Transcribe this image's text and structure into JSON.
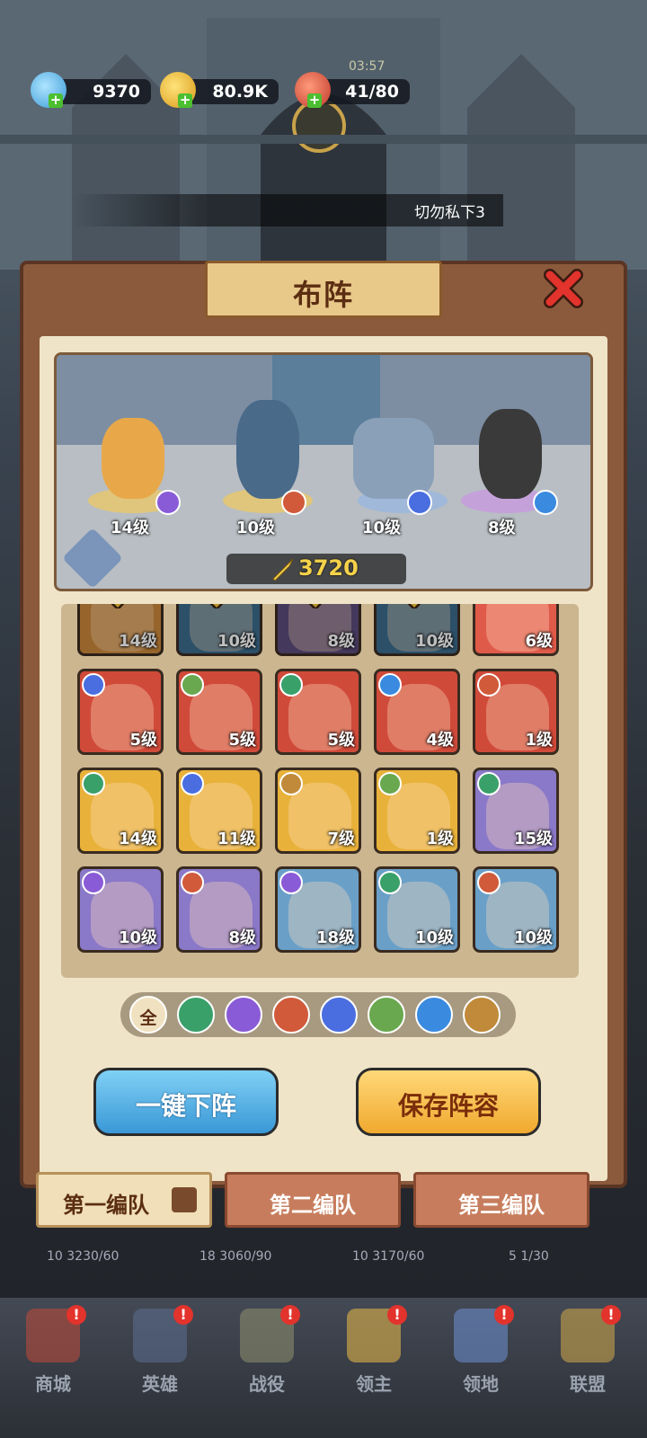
{
  "resources": {
    "gems": "9370",
    "gold": "80.9K",
    "stamina": "41/80",
    "timer": "03:57"
  },
  "notice": "切勿私下3",
  "panel": {
    "title": "布阵",
    "power": "3720"
  },
  "lineup": [
    {
      "level": "14级",
      "class_icon": "staff-icon",
      "class_color": "#8a5bd6"
    },
    {
      "level": "10级",
      "class_icon": "sword-icon",
      "class_color": "#d05a3a"
    },
    {
      "level": "10级",
      "class_icon": "paw-icon",
      "class_color": "#4a6ee0"
    },
    {
      "level": "8级",
      "class_icon": "swirl-icon",
      "class_color": "#3a8ae0"
    }
  ],
  "heroes": [
    {
      "level": "14级",
      "bg": "#c9873a",
      "deployed": true
    },
    {
      "level": "10级",
      "bg": "#3a6b8a",
      "deployed": true
    },
    {
      "level": "8级",
      "bg": "#5a4a7a",
      "deployed": true
    },
    {
      "level": "10级",
      "bg": "#3a6b8a",
      "deployed": true
    },
    {
      "level": "6级",
      "bg": "#e05a4a",
      "deployed": false,
      "class_color": "#d05a3a"
    },
    {
      "level": "5级",
      "bg": "#d04a3a",
      "class_color": "#4a6ee0"
    },
    {
      "level": "5级",
      "bg": "#d04a3a",
      "class_color": "#6aa84f"
    },
    {
      "level": "5级",
      "bg": "#d04a3a",
      "class_color": "#3aa06a"
    },
    {
      "level": "4级",
      "bg": "#d04a3a",
      "class_color": "#3a8ae0"
    },
    {
      "level": "1级",
      "bg": "#d04a3a",
      "class_color": "#d05a3a"
    },
    {
      "level": "14级",
      "bg": "#e8b23a",
      "class_color": "#3aa06a"
    },
    {
      "level": "11级",
      "bg": "#e8b23a",
      "class_color": "#4a6ee0"
    },
    {
      "level": "7级",
      "bg": "#e8b23a",
      "class_color": "#c08a3a"
    },
    {
      "level": "1级",
      "bg": "#e8b23a",
      "class_color": "#6aa84f"
    },
    {
      "level": "15级",
      "bg": "#8a78c8",
      "class_color": "#3aa06a"
    },
    {
      "level": "10级",
      "bg": "#8a78c8",
      "class_color": "#8a5bd6"
    },
    {
      "level": "8级",
      "bg": "#8a78c8",
      "class_color": "#d05a3a"
    },
    {
      "level": "18级",
      "bg": "#6aa0c8",
      "class_color": "#8a5bd6"
    },
    {
      "level": "10级",
      "bg": "#6aa0c8",
      "class_color": "#3aa06a"
    },
    {
      "level": "10级",
      "bg": "#6aa0c8",
      "class_color": "#d05a3a"
    }
  ],
  "filters": [
    {
      "label": "全",
      "name": "filter-all",
      "color": "#f0e2c0"
    },
    {
      "label": "",
      "name": "filter-bow",
      "color": "#3aa06a"
    },
    {
      "label": "",
      "name": "filter-staff",
      "color": "#8a5bd6"
    },
    {
      "label": "",
      "name": "filter-sword",
      "color": "#d05a3a"
    },
    {
      "label": "",
      "name": "filter-paw",
      "color": "#4a6ee0"
    },
    {
      "label": "",
      "name": "filter-skull",
      "color": "#6aa84f"
    },
    {
      "label": "",
      "name": "filter-swirl",
      "color": "#3a8ae0"
    },
    {
      "label": "",
      "name": "filter-wings",
      "color": "#c08a3a"
    }
  ],
  "buttons": {
    "unload_all": "一键下阵",
    "save_lineup": "保存阵容"
  },
  "tabs": [
    "第一编队",
    "第二编队",
    "第三编队"
  ],
  "behind_stats": [
    "10 3230/60",
    "18 3060/90",
    "10 3170/60",
    "5 1/30"
  ],
  "nav": [
    {
      "label": "商城",
      "icon": "shop-icon",
      "color": "#b84a3a"
    },
    {
      "label": "英雄",
      "icon": "cards-icon",
      "color": "#5a6a8a"
    },
    {
      "label": "战役",
      "icon": "swords-icon",
      "color": "#8a8a6a"
    },
    {
      "label": "领主",
      "icon": "crown-icon",
      "color": "#e0b24a"
    },
    {
      "label": "领地",
      "icon": "castle-icon",
      "color": "#6a8ac8"
    },
    {
      "label": "联盟",
      "icon": "helmet-icon",
      "color": "#c8a24a"
    }
  ],
  "nav_alert": "!"
}
